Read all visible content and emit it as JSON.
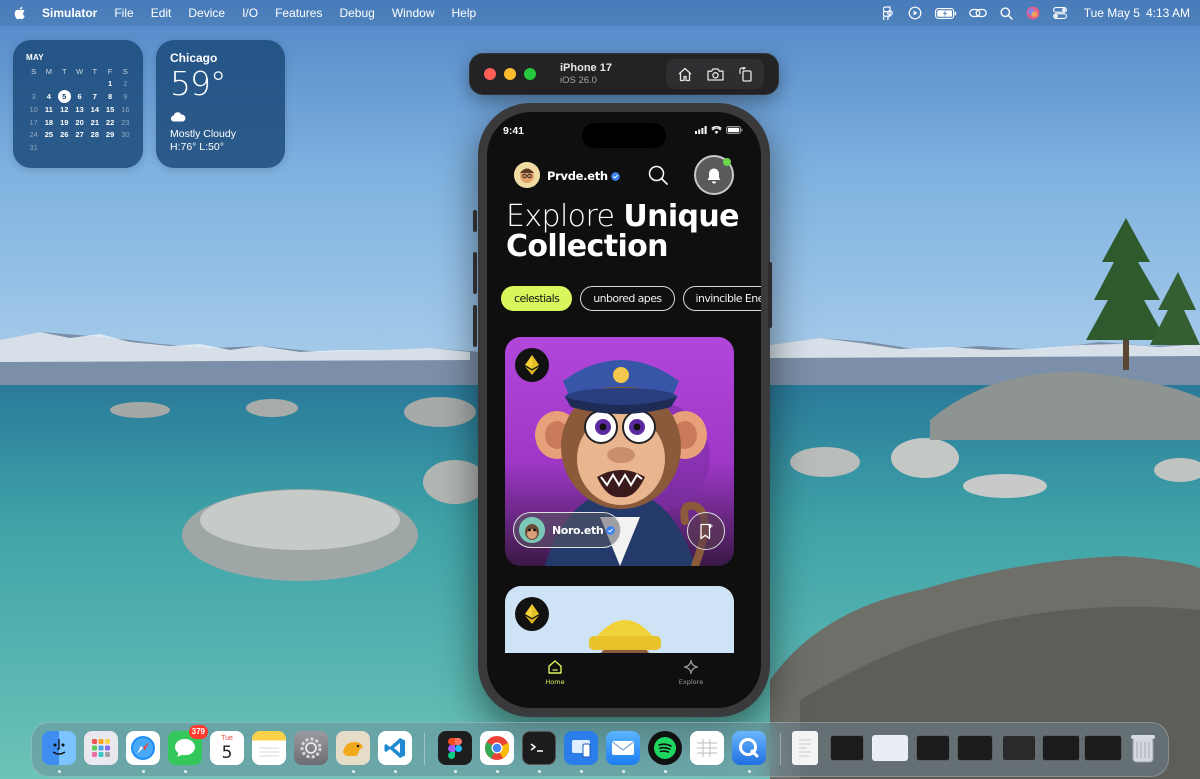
{
  "menubar": {
    "app_name": "Simulator",
    "items": [
      "File",
      "Edit",
      "Device",
      "I/O",
      "Features",
      "Debug",
      "Window",
      "Help"
    ],
    "status_icons": [
      "figma-icon",
      "play-icon",
      "battery-icon",
      "link-icon",
      "search-icon",
      "siri-icon",
      "control-center-icon"
    ],
    "date": "Tue May 5",
    "time": "4:13 AM"
  },
  "calendar_widget": {
    "month": "MAY",
    "weekday_headers": [
      "S",
      "M",
      "T",
      "W",
      "T",
      "F",
      "S"
    ],
    "today": "5",
    "weeks": [
      [
        "26",
        "27",
        "28",
        "29",
        "30",
        "1",
        "2"
      ],
      [
        "3",
        "4",
        "5",
        "6",
        "7",
        "8",
        "9"
      ],
      [
        "10",
        "11",
        "12",
        "13",
        "14",
        "15",
        "16"
      ],
      [
        "17",
        "18",
        "19",
        "20",
        "21",
        "22",
        "23"
      ],
      [
        "24",
        "25",
        "26",
        "27",
        "28",
        "29",
        "30"
      ],
      [
        "31",
        "",
        "",
        "",
        "",
        "",
        ""
      ]
    ]
  },
  "weather_widget": {
    "city": "Chicago",
    "temperature": "59°",
    "condition": "Mostly Cloudy",
    "high_low": "H:76° L:50°"
  },
  "simulator": {
    "device_name": "iPhone 17",
    "os_version": "iOS 26.0",
    "toolbar_buttons": [
      "home-icon",
      "screenshot-icon",
      "rotate-icon"
    ]
  },
  "phone": {
    "status_time": "9:41",
    "username": "Prvde.eth",
    "headline_light": "Explore",
    "headline_bold_1": "Unique",
    "headline_bold_2": "Collection",
    "chips": [
      {
        "label": "celestials",
        "active": true
      },
      {
        "label": "unbored apes",
        "active": false
      },
      {
        "label": "invincible Enemie",
        "active": false
      }
    ],
    "card1_owner": "Noro.eth",
    "tabs": [
      {
        "label": "Home",
        "active": true
      },
      {
        "label": "Explore",
        "active": false
      }
    ]
  },
  "dock": {
    "messages_badge": "379",
    "calendar_month": "Tue",
    "calendar_day": "5"
  },
  "colors": {
    "accent_lime": "#d9f65d",
    "app_background": "#0f0f10",
    "card_purple": "#b247db",
    "notification_dot": "#6bd64a"
  }
}
